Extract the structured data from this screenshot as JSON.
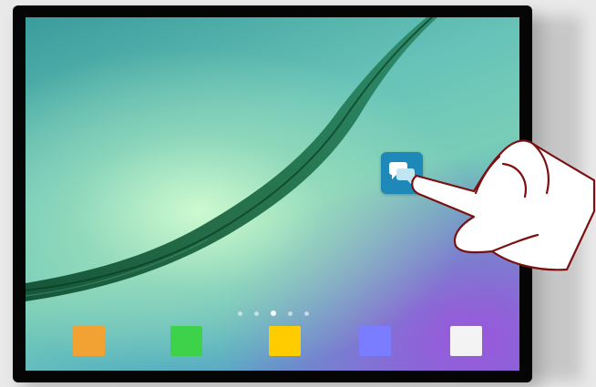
{
  "device": {
    "type": "tablet"
  },
  "home_screen": {
    "app_icon": {
      "icon": "chat-bubbles-icon",
      "color": "#1e88b8"
    },
    "page_indicator": {
      "count": 5,
      "active_index": 2
    },
    "dock": [
      {
        "name": "dock-app-orange",
        "color": "#f2a232"
      },
      {
        "name": "dock-app-green",
        "color": "#3ed14a"
      },
      {
        "name": "dock-app-yellow",
        "color": "#ffcc00"
      },
      {
        "name": "dock-app-purple",
        "color": "#7a7dff"
      },
      {
        "name": "dock-app-white",
        "color": "#f3f3f3"
      }
    ]
  },
  "gesture": {
    "icon": "pointing-hand-icon",
    "target": "chat-app-icon"
  }
}
